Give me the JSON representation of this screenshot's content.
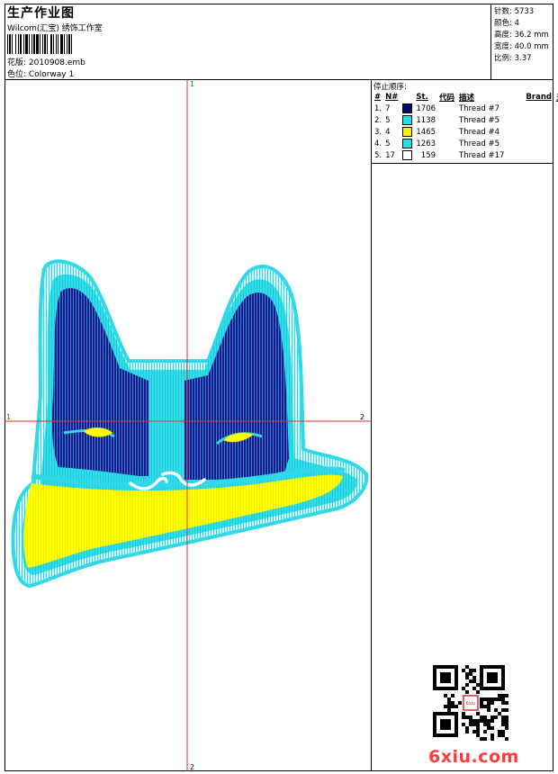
{
  "header": {
    "title": "生产作业图",
    "company": "Wilcom(汇宝) 绣饰工作室",
    "design_label": "花版:",
    "design_file": "2010908.emb",
    "colorway_label": "色位:",
    "colorway": "Colorway 1"
  },
  "stats": [
    {
      "label": "针数:",
      "value": "5733"
    },
    {
      "label": "颜色:",
      "value": "4"
    },
    {
      "label": "高度:",
      "value": "36.2 mm"
    },
    {
      "label": "宽度:",
      "value": "40.0 mm"
    },
    {
      "label": "比例:",
      "value": "3.37"
    }
  ],
  "legend": {
    "caption": "停止顺序:",
    "columns": [
      "#",
      "N#",
      "St.",
      "代码",
      "描述",
      "Brand",
      "元素"
    ],
    "rows": [
      {
        "seq": "1.",
        "n": "7",
        "color": "#0a0a6e",
        "st": "1706",
        "desc": "Thread #7"
      },
      {
        "seq": "2.",
        "n": "5",
        "color": "#22e1e6",
        "st": "1138",
        "desc": "Thread #5"
      },
      {
        "seq": "3.",
        "n": "4",
        "color": "#fff200",
        "st": "1465",
        "desc": "Thread #4"
      },
      {
        "seq": "4.",
        "n": "5",
        "color": "#22e1e6",
        "st": "1263",
        "desc": "Thread #5"
      },
      {
        "seq": "5.",
        "n": "17",
        "color": "#ffffff",
        "st": "159",
        "desc": "Thread #17"
      }
    ]
  },
  "canvas": {
    "marker_top": "1",
    "marker_bottom": "2",
    "marker_left": "1",
    "marker_right": "2"
  },
  "watermark": {
    "qr_stamp": "6xiu",
    "site": "6xiu.com"
  }
}
